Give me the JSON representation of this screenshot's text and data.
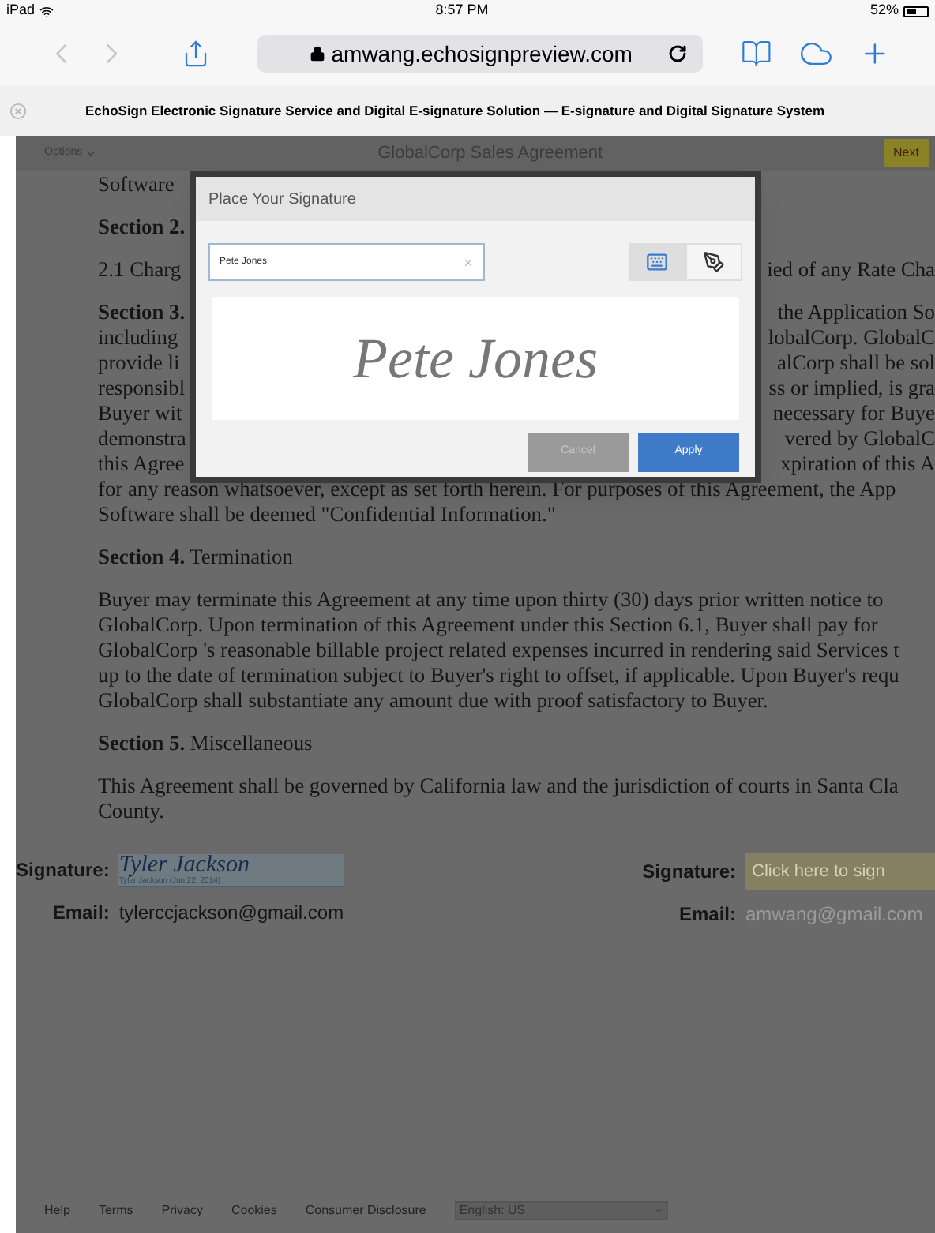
{
  "status_bar": {
    "device": "iPad",
    "time": "8:57 PM",
    "battery": "52%"
  },
  "browser": {
    "nav": [
      {
        "kind": "back",
        "disabled": true
      },
      {
        "kind": "forward",
        "disabled": true
      }
    ],
    "url": "amwang.echosignpreview.com",
    "tab_title": "EchoSign Electronic Signature Service and Digital E-signature Solution — E-signature and Digital Signature System"
  },
  "document_bar": {
    "options": "Options",
    "title": "GlobalCorp Sales Agreement",
    "next": "Next"
  },
  "paragraphs": [
    {
      "lines": [
        {
          "left": "Software"
        }
      ]
    },
    {
      "lines": [
        {
          "left": "**Section 2.**"
        }
      ]
    },
    {
      "lines": [
        {
          "left": "2.1 Charg",
          "right": "ied of any Rate Cha"
        }
      ]
    },
    {
      "lines": [
        {
          "left": "**Section 3.**",
          "right": "the Application So"
        },
        {
          "left": "including",
          "right": "lobalCorp. GlobalC"
        },
        {
          "left": "provide li",
          "right": "alCorp shall be sol"
        },
        {
          "left": "responsibl",
          "right": "ss or implied, is gra"
        },
        {
          "left": "Buyer wit",
          "right": "necessary for Buye"
        },
        {
          "left": "demonstra",
          "right": "vered by GlobalC"
        },
        {
          "left": "this Agree",
          "right": "xpiration of this A"
        },
        {
          "left": "for any reason whatsoever, except as set forth herein. For purposes of this Agreement, the App"
        },
        {
          "left": "Software shall be deemed \"Confidential Information.\""
        }
      ]
    },
    {
      "lines": [
        {
          "left": "**Section 4.** Termination"
        }
      ]
    },
    {
      "lines": [
        {
          "left": "Buyer may terminate this Agreement at any time upon thirty (30) days prior written notice to"
        },
        {
          "left": "GlobalCorp. Upon termination of this Agreement under this Section 6.1, Buyer shall pay for"
        },
        {
          "left": "GlobalCorp 's reasonable billable project related expenses incurred in rendering said Services t"
        },
        {
          "left": "up to the date of termination subject to Buyer's right to offset, if applicable. Upon Buyer's requ"
        },
        {
          "left": "GlobalCorp shall substantiate any amount due with proof satisfactory to Buyer."
        }
      ]
    },
    {
      "lines": [
        {
          "left": "**Section 5.** Miscellaneous"
        }
      ]
    },
    {
      "lines": [
        {
          "left": "This Agreement shall be governed by California law and the jurisdiction of courts in Santa Cla"
        },
        {
          "left": "County."
        }
      ]
    }
  ],
  "signers": [
    {
      "kind": "signed",
      "signature_label": "Signature:",
      "signature": "Tyler Jackson",
      "caption": "Tyler Jackson (Jun 22, 2014)",
      "email_label": "Email:",
      "email": "tylerccjackson@gmail.com"
    },
    {
      "kind": "unsigned",
      "signature_label": "Signature:",
      "sign_button": "Click here to sign",
      "email_label": "Email:",
      "email": "amwang@gmail.com"
    }
  ],
  "footer": {
    "links": [
      "Help",
      "Terms",
      "Privacy",
      "Cookies",
      "Consumer Disclosure"
    ],
    "language": "English: US"
  },
  "dialog": {
    "title": "Place Your Signature",
    "name_value": "Pete Jones",
    "modes": [
      {
        "kind": "type",
        "selected": true
      },
      {
        "kind": "draw",
        "selected": false
      }
    ],
    "preview": "Pete Jones",
    "buttons": [
      {
        "kind": "secondary",
        "label": "Cancel"
      },
      {
        "kind": "primary",
        "label": "Apply"
      }
    ]
  }
}
